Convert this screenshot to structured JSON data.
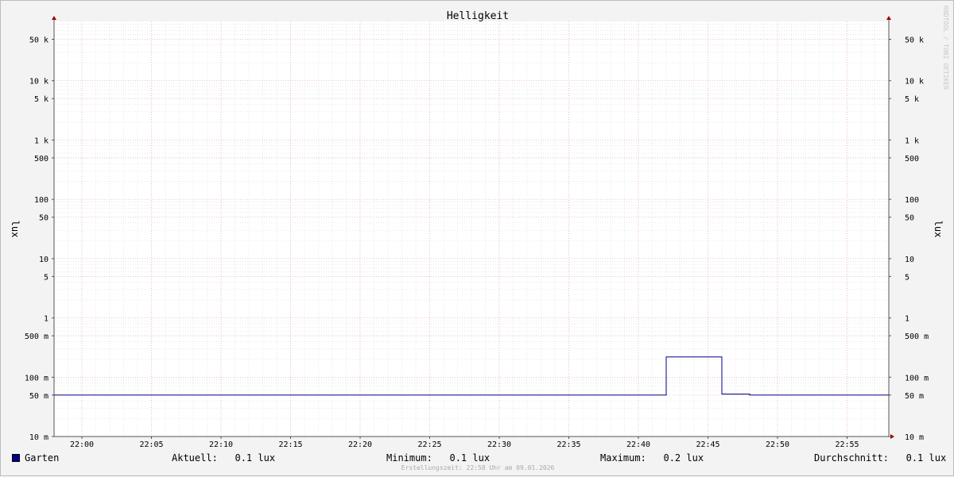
{
  "chart_data": {
    "type": "line",
    "title": "Helligkeit",
    "ylabel": "lux",
    "yscale": "log",
    "ylim": [
      0.01,
      100000
    ],
    "y_ticks": [
      {
        "value": 0.01,
        "label": "10 m"
      },
      {
        "value": 0.05,
        "label": "50 m"
      },
      {
        "value": 0.1,
        "label": "100 m"
      },
      {
        "value": 0.5,
        "label": "500 m"
      },
      {
        "value": 1,
        "label": "1"
      },
      {
        "value": 5,
        "label": "5"
      },
      {
        "value": 10,
        "label": "10"
      },
      {
        "value": 50,
        "label": "50"
      },
      {
        "value": 100,
        "label": "100"
      },
      {
        "value": 500,
        "label": "500"
      },
      {
        "value": 1000,
        "label": "1 k"
      },
      {
        "value": 5000,
        "label": "5 k"
      },
      {
        "value": 10000,
        "label": "10 k"
      },
      {
        "value": 50000,
        "label": "50 k"
      }
    ],
    "x_ticks": [
      "22:00",
      "22:05",
      "22:10",
      "22:15",
      "22:20",
      "22:25",
      "22:30",
      "22:35",
      "22:40",
      "22:45",
      "22:50",
      "22:55"
    ],
    "xlim": [
      "21:58",
      "22:58"
    ],
    "grid": true,
    "series": [
      {
        "name": "Garten",
        "color": "#00008b",
        "x": [
          "21:58",
          "22:42",
          "22:42",
          "22:46",
          "22:46",
          "22:48",
          "22:48",
          "22:58"
        ],
        "y": [
          0.05,
          0.05,
          0.22,
          0.22,
          0.052,
          0.052,
          0.05,
          0.05
        ]
      }
    ]
  },
  "legend": {
    "series_name": "Garten",
    "swatch_color": "#00008b",
    "current": "Aktuell:   0.1 lux",
    "minimum": "Minimum:   0.1 lux",
    "maximum": "Maximum:   0.2 lux",
    "average": "Durchschnitt:   0.1 lux"
  },
  "footer": "Erstellungszeit: 22:58 Uhr am 09.01.2026",
  "watermark": "RRDTOOL / TOBI OETIKER"
}
